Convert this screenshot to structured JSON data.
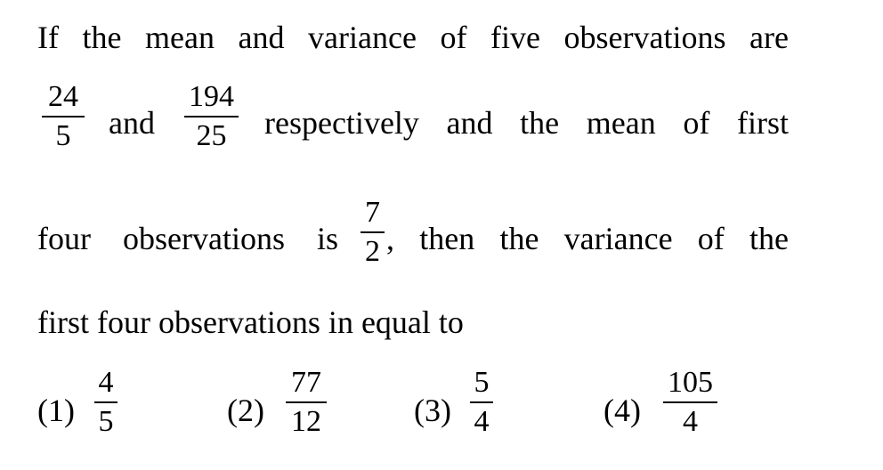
{
  "question": {
    "line1": "If the mean and variance of five observations are",
    "frac_mean": {
      "num": "24",
      "den": "5"
    },
    "and_word": "and",
    "frac_variance": {
      "num": "194",
      "den": "25"
    },
    "line2_rest": "respectively and the mean of first",
    "line3_start": "four observations is",
    "frac_mean4": {
      "num": "7",
      "den": "2"
    },
    "line3_rest": ", then the variance of the",
    "line4": "first four observations in equal to"
  },
  "options": [
    {
      "label": "(1)",
      "num": "4",
      "den": "5"
    },
    {
      "label": "(2)",
      "num": "77",
      "den": "12"
    },
    {
      "label": "(3)",
      "num": "5",
      "den": "4"
    },
    {
      "label": "(4)",
      "num": "105",
      "den": "4"
    }
  ]
}
